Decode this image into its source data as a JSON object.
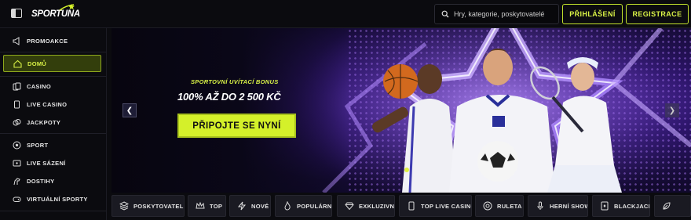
{
  "header": {
    "logo_text": "SPORTUNA",
    "search_placeholder": "Hry, kategorie, poskytovatelé",
    "login_label": "PŘIHLÁŠENÍ",
    "register_label": "REGISTRACE"
  },
  "sidebar": {
    "items": [
      {
        "label": "PROMOAKCE",
        "icon": "megaphone-icon"
      },
      {
        "label": "DOMŮ",
        "icon": "home-icon",
        "active": true
      },
      {
        "label": "CASINO",
        "icon": "cards-icon"
      },
      {
        "label": "LIVE CASINO",
        "icon": "phone-icon"
      },
      {
        "label": "JACKPOTY",
        "icon": "coins-icon"
      },
      {
        "label": "SPORT",
        "icon": "football-icon"
      },
      {
        "label": "LIVE SÁZENÍ",
        "icon": "live-icon"
      },
      {
        "label": "DOSTIHY",
        "icon": "horse-icon"
      },
      {
        "label": "VIRTUÁLNÍ SPORTY",
        "icon": "gamepad-icon"
      }
    ]
  },
  "hero": {
    "subtitle": "SPORTOVNÍ UVÍTACÍ BONUS",
    "title": "100% AŽ DO 2 500 KČ",
    "cta_label": "PŘIPOJTE SE NYNÍ"
  },
  "categories": [
    {
      "label": "POSKYTOVATELÉ",
      "icon": "layers-icon"
    },
    {
      "label": "TOP",
      "icon": "crown-icon"
    },
    {
      "label": "NOVÉ",
      "icon": "lightning-icon"
    },
    {
      "label": "POPULÁRNÍ",
      "icon": "flame-icon"
    },
    {
      "label": "EXKLUZIVNÍ",
      "icon": "diamond-icon"
    },
    {
      "label": "TOP LIVE CASINO",
      "icon": "phone-icon"
    },
    {
      "label": "RULETA",
      "icon": "roulette-icon"
    },
    {
      "label": "HERNÍ SHOW",
      "icon": "microphone-icon"
    },
    {
      "label": "BLACKJACK",
      "icon": "card-icon"
    },
    {
      "label": "",
      "icon": "leaf-icon"
    }
  ],
  "colors": {
    "accent": "#d4f02a",
    "background": "#0b0b0f",
    "hero_purple": "#5a2fb0"
  }
}
